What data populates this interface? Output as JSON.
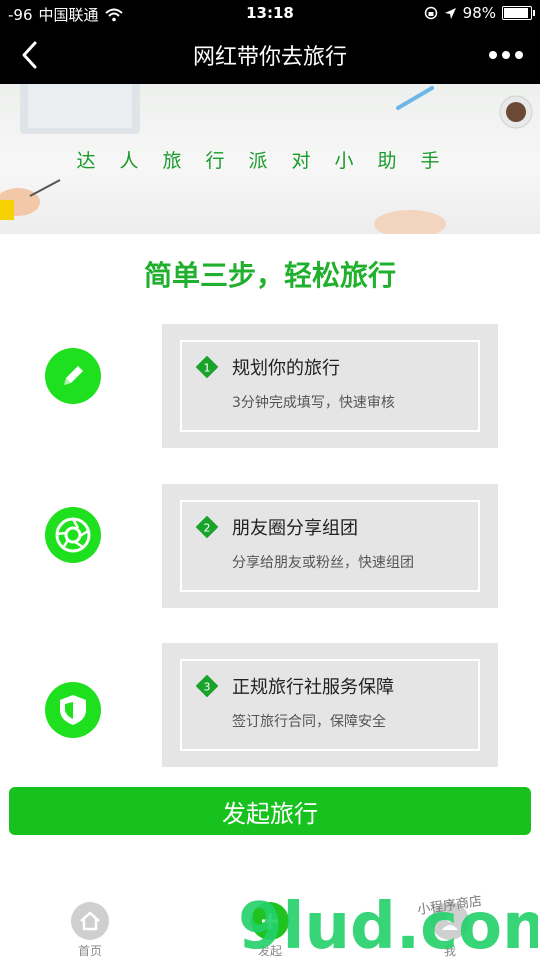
{
  "status_bar": {
    "signal": "-96",
    "carrier": "中国联通",
    "time": "13:18",
    "battery_percent": "98%",
    "battery_level": 0.98
  },
  "nav": {
    "title": "网红带你去旅行",
    "back_icon": "chevron-left-icon",
    "more_icon": "more-dots-icon"
  },
  "banner": {
    "tagline": "达人旅行派对小助手"
  },
  "headline": "简单三步，轻松旅行",
  "steps": [
    {
      "number": "1",
      "title": "规划你的旅行",
      "desc": "3分钟完成填写，快速审核",
      "icon": "pencil-icon"
    },
    {
      "number": "2",
      "title": "朋友圈分享组团",
      "desc": "分享给朋友或粉丝，快速组团",
      "icon": "camera-shutter-icon"
    },
    {
      "number": "3",
      "title": "正规旅行社服务保障",
      "desc": "签订旅行合同，保障安全",
      "icon": "shield-check-icon"
    }
  ],
  "cta_label": "发起旅行",
  "tabbar": {
    "items": [
      {
        "label": "首页",
        "icon": "home-icon"
      },
      {
        "label": "发起",
        "icon": "plus-icon"
      },
      {
        "label": "我",
        "icon": "user-icon"
      }
    ]
  },
  "watermark": {
    "text": "9lud.com",
    "subtext": "小程序商店"
  },
  "colors": {
    "brand_green": "#21b02d",
    "icon_green": "#1fe01f",
    "cta_green": "#18c21e",
    "card_gray": "#e5e5e5"
  }
}
